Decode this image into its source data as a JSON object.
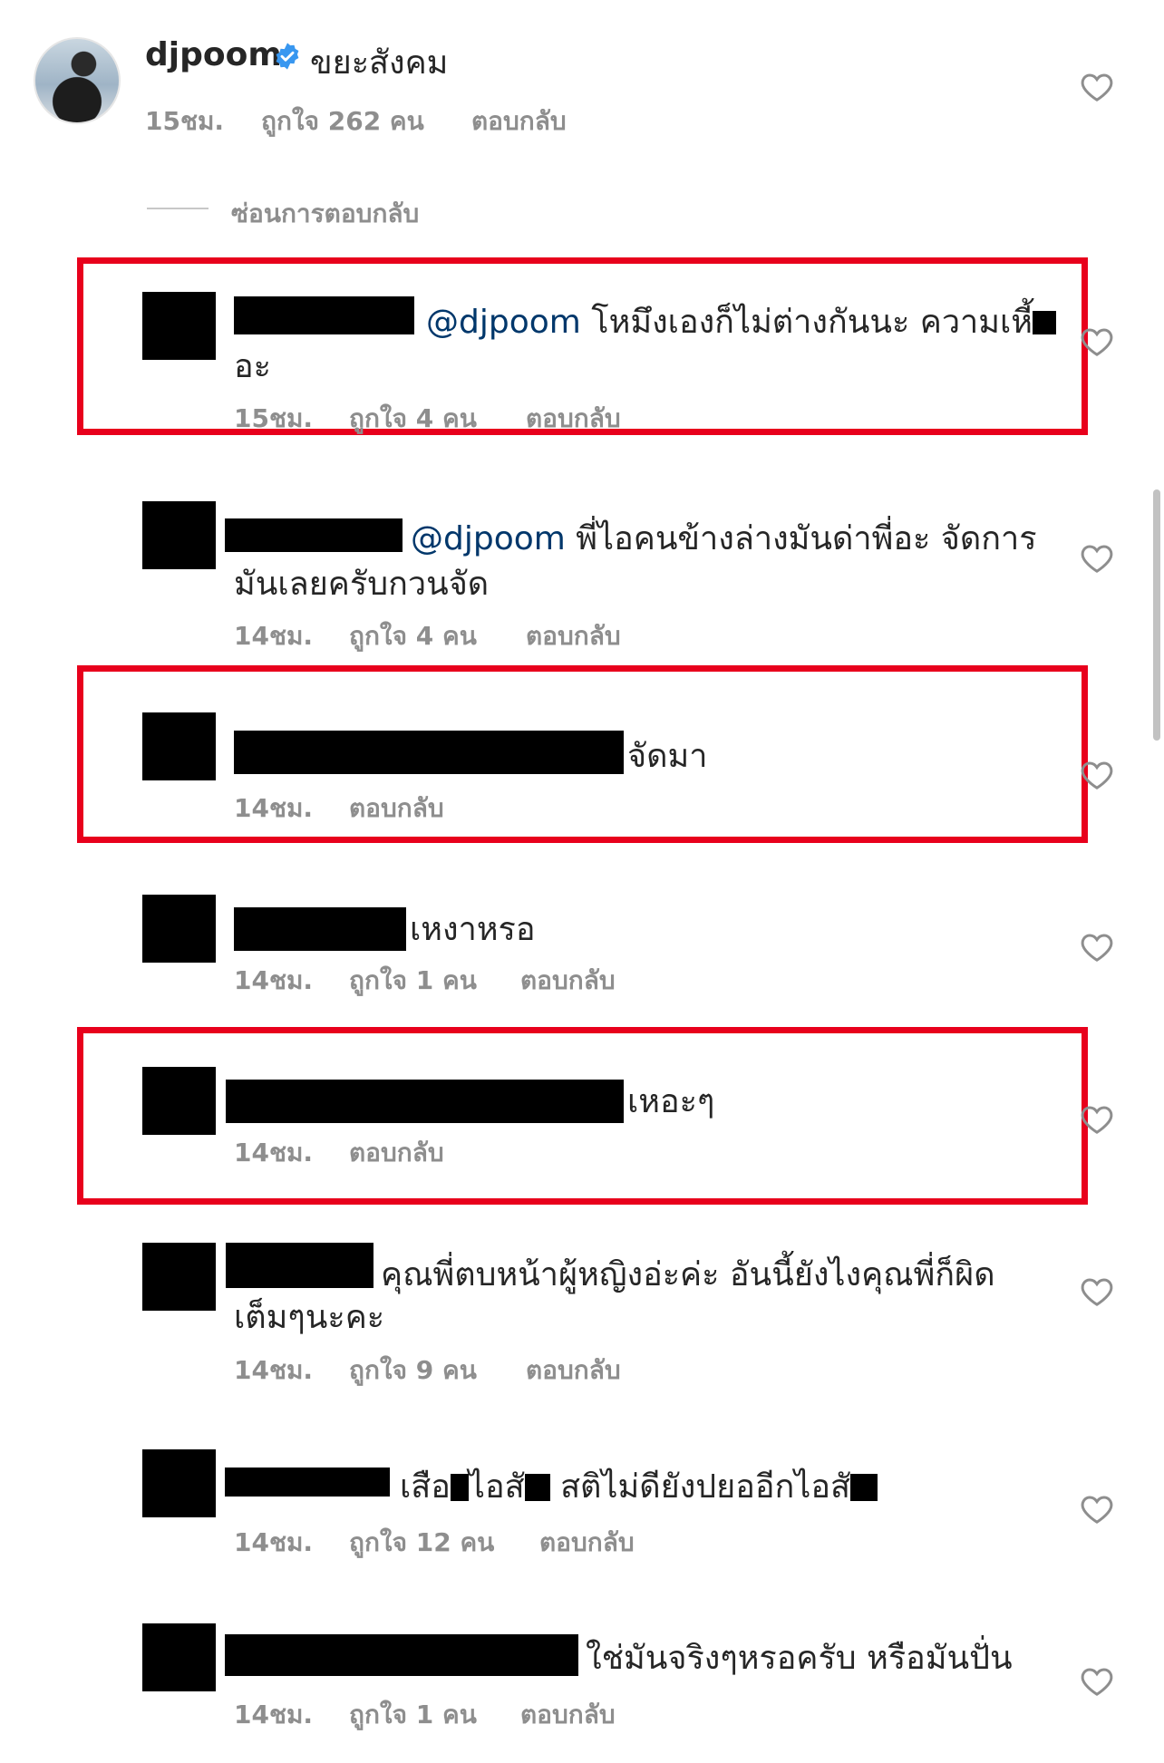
{
  "post": {
    "username": "djpoom",
    "comment": "ขยะสังคม",
    "time": "15ชม.",
    "likes": "ถูกใจ 262 คน",
    "reply": "ตอบกลับ"
  },
  "hide_replies": "ซ่อนการตอบกลับ",
  "replies": [
    {
      "mention": "@djpoom",
      "line1": "โหมึงเองก็ไม่ต่างกันนะ ความเหี้",
      "line2": "อะ",
      "time": "15ชม.",
      "likes": "ถูกใจ 4 คน",
      "reply": "ตอบกลับ",
      "highlighted": true
    },
    {
      "mention": "@djpoom",
      "line1": "พี่ไอคนข้างล่างมันด่าพี่อะ จัดการ",
      "line2": "มันเลยครับกวนจัด",
      "time": "14ชม.",
      "likes": "ถูกใจ 4 คน",
      "reply": "ตอบกลับ",
      "highlighted": false
    },
    {
      "line1": "จัดมา",
      "time": "14ชม.",
      "reply": "ตอบกลับ",
      "highlighted": true
    },
    {
      "line1": "เหงาหรอ",
      "time": "14ชม.",
      "likes": "ถูกใจ 1 คน",
      "reply": "ตอบกลับ",
      "highlighted": false
    },
    {
      "line1": "เหอะๆ",
      "time": "14ชม.",
      "reply": "ตอบกลับ",
      "highlighted": true
    },
    {
      "line1": "คุณพี่ตบหน้าผู้หญิงอ่ะค่ะ อันนี้ยังไงคุณพี่ก็ผิด",
      "line2": "เต็มๆนะคะ",
      "time": "14ชม.",
      "likes": "ถูกใจ 9 คน",
      "reply": "ตอบกลับ",
      "highlighted": false
    },
    {
      "line1_a": "เสือ",
      "line1_b": "ไอสั",
      "line1_c": "สติไม่ดียังปยออีกไอสั",
      "time": "14ชม.",
      "likes": "ถูกใจ 12 คน",
      "reply": "ตอบกลับ",
      "highlighted": false
    },
    {
      "line1": "ใช่มันจริงๆหรอครับ หรือมันปั่น",
      "time": "14ชม.",
      "likes": "ถูกใจ 1 คน",
      "reply": "ตอบกลับ",
      "highlighted": false
    }
  ],
  "colors": {
    "mention": "#00376b",
    "highlight_box": "#e8001c",
    "meta_text": "#8e8e8e",
    "verified": "#3897f0"
  },
  "icons": {
    "like": "heart-outline-icon",
    "verified": "verified-badge-icon"
  }
}
